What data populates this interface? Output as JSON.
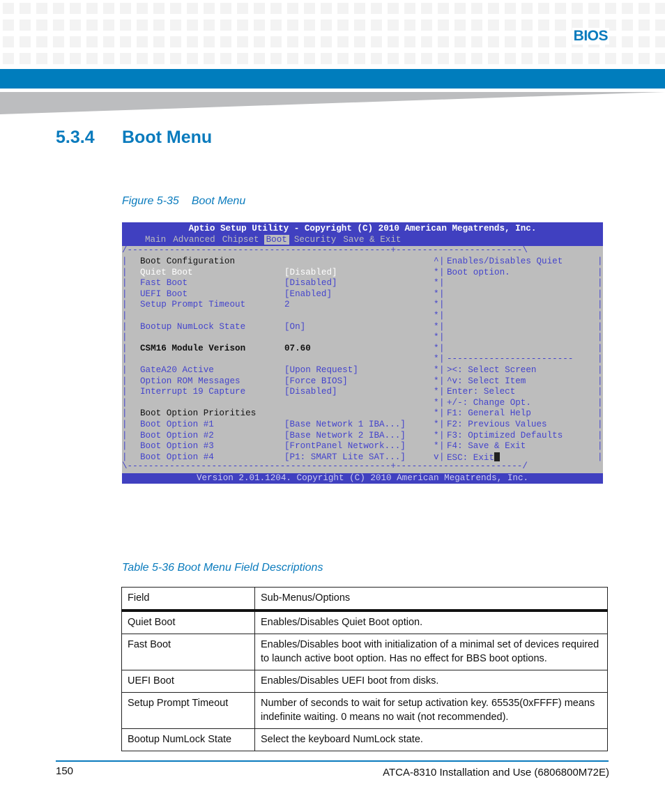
{
  "header": {
    "chapter": "BIOS",
    "colors": {
      "accent": "#007dbd",
      "pattern": "#f3f3f3",
      "wedge": "#bcbdbf"
    }
  },
  "section": {
    "number": "5.3.4",
    "title": "Boot Menu"
  },
  "figure": {
    "label": "Figure 5-35",
    "title": "Boot Menu"
  },
  "bios": {
    "title": "Aptio Setup Utility - Copyright (C) 2010 American Megatrends, Inc.",
    "tabs": [
      {
        "label": "Main",
        "active": false
      },
      {
        "label": "Advanced",
        "active": false
      },
      {
        "label": "Chipset",
        "active": false
      },
      {
        "label": "Boot",
        "active": true
      },
      {
        "label": "Security",
        "active": false
      },
      {
        "label": "Save & Exit",
        "active": false
      }
    ],
    "top_border": "/--------------------------------------------------+------------------------\\",
    "bottom_border": "\\--------------------------------------------------+------------------------/",
    "rows": [
      {
        "label": "Boot Configuration",
        "value": "",
        "style": "heading",
        "gutter": "^",
        "help": "Enables/Disables Quiet"
      },
      {
        "label": "Quiet Boot",
        "value": "[Disabled]",
        "style": "selected",
        "gutter": "*",
        "help": "Boot option."
      },
      {
        "label": "Fast Boot",
        "value": "[Disabled]",
        "style": "item",
        "gutter": "*",
        "help": ""
      },
      {
        "label": "UEFI Boot",
        "value": "[Enabled]",
        "style": "item",
        "gutter": "*",
        "help": ""
      },
      {
        "label": "Setup Prompt Timeout",
        "value": "2",
        "style": "item",
        "gutter": "*",
        "help": ""
      },
      {
        "label": "",
        "value": "",
        "style": "blank",
        "gutter": "*",
        "help": ""
      },
      {
        "label": "Bootup NumLock State",
        "value": "[On]",
        "style": "item",
        "gutter": "*",
        "help": ""
      },
      {
        "label": "",
        "value": "",
        "style": "blank",
        "gutter": "*",
        "help": ""
      },
      {
        "label": "CSM16 Module Verison",
        "value": "07.60",
        "style": "info",
        "gutter": "*",
        "help": ""
      },
      {
        "label": "",
        "value": "",
        "style": "blank",
        "gutter": "*",
        "help": "------------------------"
      },
      {
        "label": "GateA20 Active",
        "value": "[Upon Request]",
        "style": "item",
        "gutter": "*",
        "help": "><: Select Screen"
      },
      {
        "label": "Option ROM Messages",
        "value": "[Force BIOS]",
        "style": "item",
        "gutter": "*",
        "help": "^v: Select Item"
      },
      {
        "label": "Interrupt 19 Capture",
        "value": "[Disabled]",
        "style": "item",
        "gutter": "*",
        "help": "Enter: Select"
      },
      {
        "label": "",
        "value": "",
        "style": "blank",
        "gutter": "*",
        "help": "+/-: Change Opt."
      },
      {
        "label": "Boot Option Priorities",
        "value": "",
        "style": "heading",
        "gutter": "*",
        "help": "F1: General Help"
      },
      {
        "label": "Boot Option #1",
        "value": "[Base Network 1 IBA...]",
        "style": "item",
        "gutter": "*",
        "help": "F2: Previous Values"
      },
      {
        "label": "Boot Option #2",
        "value": "[Base Network 2 IBA...]",
        "style": "item",
        "gutter": "*",
        "help": "F3: Optimized Defaults"
      },
      {
        "label": "Boot Option #3",
        "value": "[FrontPanel Network...]",
        "style": "item",
        "gutter": "*",
        "help": "F4: Save & Exit"
      },
      {
        "label": "Boot Option #4",
        "value": "[P1: SMART Lite SAT...]",
        "style": "item",
        "gutter": "v",
        "help": "ESC: Exit"
      }
    ],
    "footer": "Version 2.01.1204. Copyright (C) 2010 American Megatrends, Inc.",
    "colors": {
      "bar": "#4040c0",
      "screen": "#bdbdbd",
      "text": "#4444cc"
    }
  },
  "table": {
    "caption": "Table 5-36 Boot Menu Field Descriptions",
    "headers": [
      "Field",
      "Sub-Menus/Options"
    ],
    "rows": [
      [
        "Quiet Boot",
        "Enables/Disables Quiet Boot option."
      ],
      [
        "Fast Boot",
        "Enables/Disables boot with initialization of a minimal set of devices required to launch active boot option. Has no effect for BBS boot options."
      ],
      [
        "UEFI Boot",
        "Enables/Disables UEFI boot from disks."
      ],
      [
        "Setup Prompt Timeout",
        "Number of seconds to wait for setup activation key. 65535(0xFFFF) means indefinite waiting. 0 means no wait (not recommended)."
      ],
      [
        "Bootup NumLock State",
        "Select the keyboard NumLock state."
      ]
    ]
  },
  "footer": {
    "page_number": "150",
    "doc_title": "ATCA-8310 Installation and Use (6806800M72E)"
  }
}
